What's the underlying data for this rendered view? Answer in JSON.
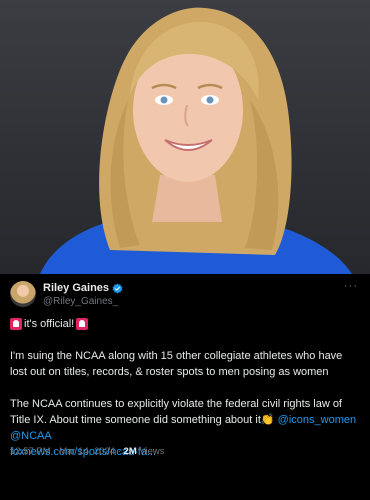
{
  "tweet": {
    "author_name": "Riley Gaines",
    "handle": "@Riley_Gaines_",
    "intro_text": "it's official!",
    "para1": "I'm suing the NCAA along with 15 other collegiate athletes who have lost out on titles, records, & roster spots to men posing as women",
    "para2_text": "The NCAA continues to explicitly violate the federal civil rights law of Title IX. About time someone did something about it",
    "mention1": "@icons_women",
    "mention2": "@NCAA",
    "link": "foxnews.com/sports/ncaa-fa...",
    "time": "12:57 PM · Mar 14, 2024 · ",
    "views_count": "2M",
    "views_label": " Views",
    "more_icon": "ellipsis-icon"
  },
  "colors": {
    "background": "#000000",
    "text": "#e7e9ea",
    "muted": "#71767b",
    "link": "#1d9bf0",
    "verified": "#1d9bf0",
    "siren": "#e0245e"
  }
}
